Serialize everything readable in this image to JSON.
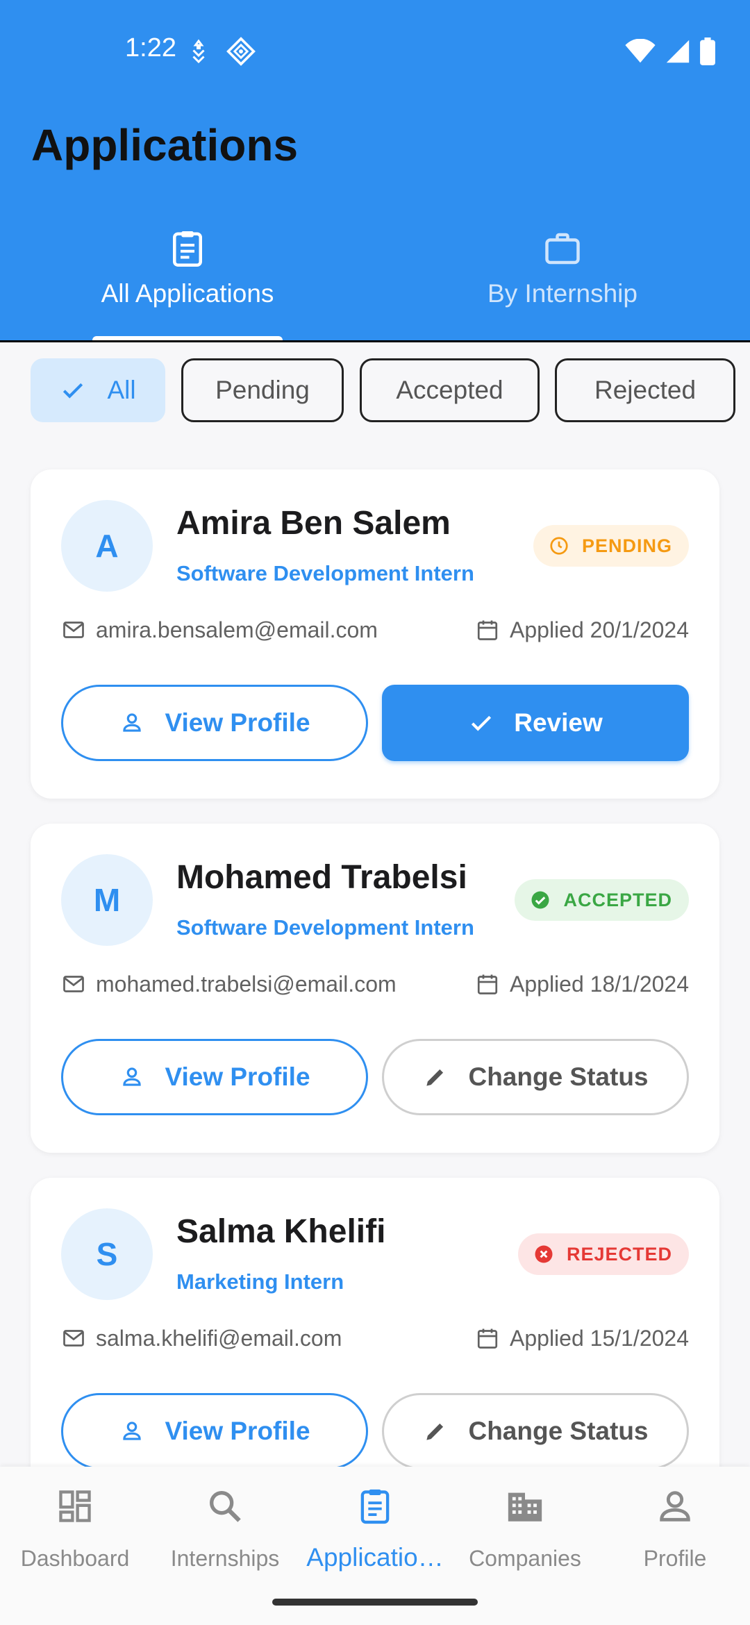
{
  "status_bar": {
    "time": "1:22"
  },
  "header": {
    "title": "Applications"
  },
  "tabs": [
    {
      "label": "All Applications",
      "icon": "clipboard-icon",
      "active": true
    },
    {
      "label": "By Internship",
      "icon": "briefcase-icon",
      "active": false
    }
  ],
  "filters": [
    {
      "label": "All",
      "selected": true
    },
    {
      "label": "Pending",
      "selected": false
    },
    {
      "label": "Accepted",
      "selected": false
    },
    {
      "label": "Rejected",
      "selected": false
    }
  ],
  "applications": [
    {
      "initial": "A",
      "name": "Amira Ben Salem",
      "role": "Software Development Intern",
      "status": "PENDING",
      "email": "amira.bensalem@email.com",
      "applied": "Applied 20/1/2024",
      "primary_action": "View Profile",
      "secondary_action": "Review"
    },
    {
      "initial": "M",
      "name": "Mohamed Trabelsi",
      "role": "Software Development Intern",
      "status": "ACCEPTED",
      "email": "mohamed.trabelsi@email.com",
      "applied": "Applied 18/1/2024",
      "primary_action": "View Profile",
      "secondary_action": "Change Status"
    },
    {
      "initial": "S",
      "name": "Salma Khelifi",
      "role": "Marketing Intern",
      "status": "REJECTED",
      "email": "salma.khelifi@email.com",
      "applied": "Applied 15/1/2024",
      "primary_action": "View Profile",
      "secondary_action": "Change Status"
    }
  ],
  "bottom_nav": [
    {
      "label": "Dashboard",
      "icon": "dashboard-icon",
      "active": false
    },
    {
      "label": "Internships",
      "icon": "search-icon",
      "active": false
    },
    {
      "label": "Applicatio…",
      "icon": "clipboard-icon",
      "active": true
    },
    {
      "label": "Companies",
      "icon": "building-icon",
      "active": false
    },
    {
      "label": "Profile",
      "icon": "person-icon",
      "active": false
    }
  ],
  "colors": {
    "primary": "#2f8ff0",
    "pending": "#f59a12",
    "accepted": "#3aa744",
    "rejected": "#e53935"
  }
}
